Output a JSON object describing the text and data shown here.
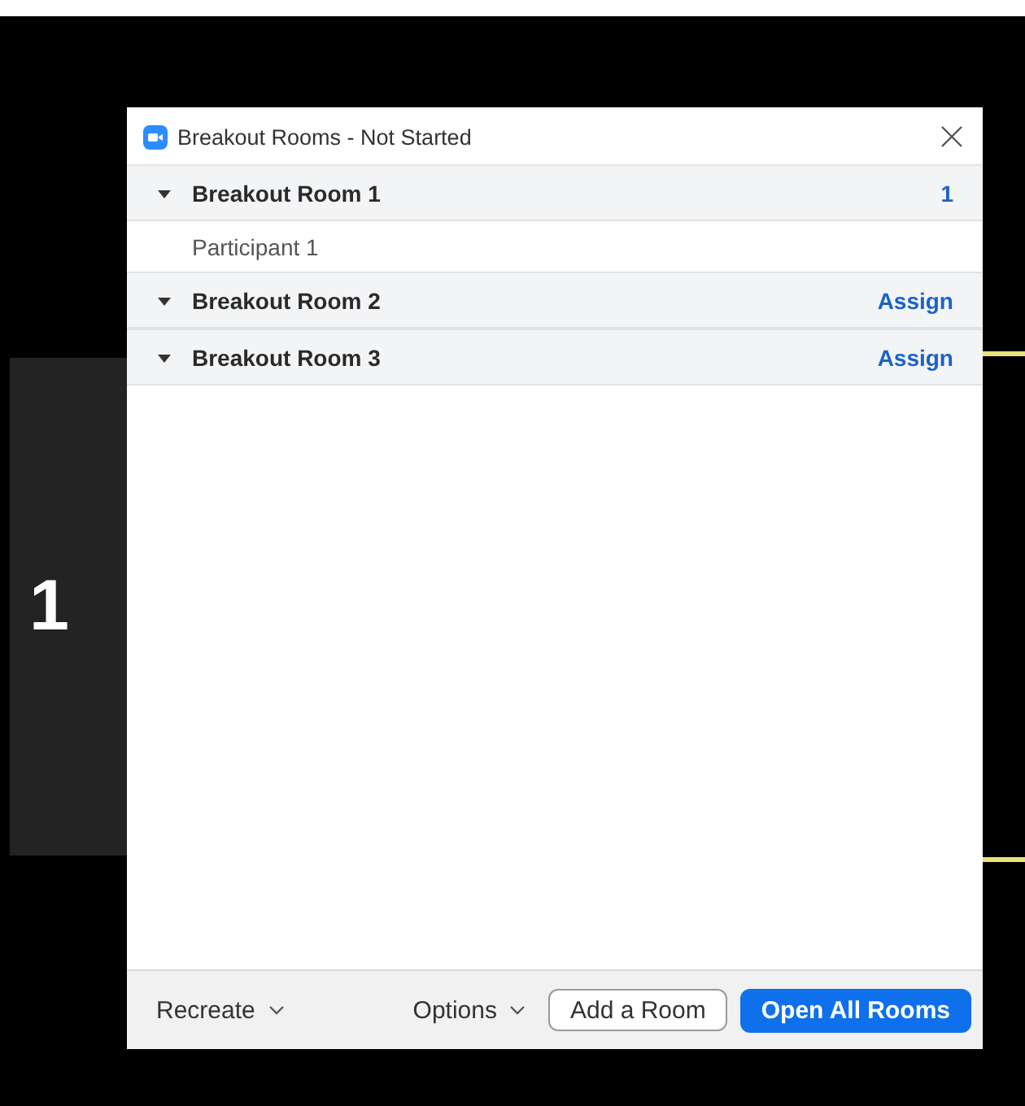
{
  "background": {
    "tile_label": "1"
  },
  "window": {
    "title": "Breakout Rooms - Not Started"
  },
  "rooms": [
    {
      "name": "Breakout Room 1",
      "expanded": true,
      "action": "1",
      "participants": [
        "Participant 1"
      ]
    },
    {
      "name": "Breakout Room 2",
      "expanded": true,
      "action": "Assign"
    },
    {
      "name": "Breakout Room 3",
      "expanded": true,
      "action": "Assign"
    }
  ],
  "footer": {
    "menus": [
      "Recreate",
      "Options"
    ],
    "secondary_button": "Add a Room",
    "primary_button": "Open All Rooms"
  }
}
